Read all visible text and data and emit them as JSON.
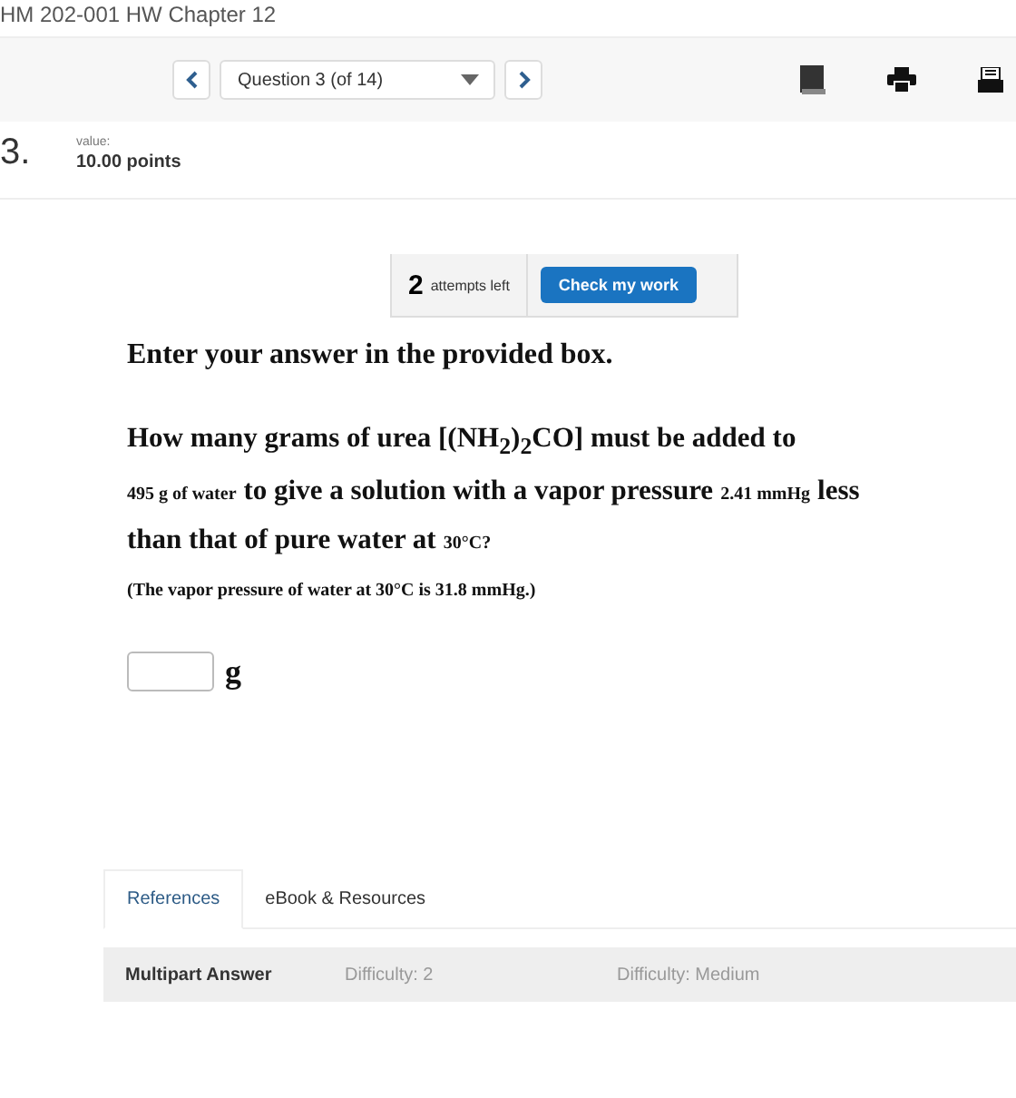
{
  "assignment_title": "HM 202-001 HW Chapter 12",
  "nav": {
    "question_select": "Question 3 (of 14)"
  },
  "question": {
    "number": "3.",
    "value_label": "value:",
    "points": "10.00 points"
  },
  "attempts": {
    "count": "2",
    "label": "attempts left",
    "button": "Check my work"
  },
  "instruction": "Enter your answer in the provided box.",
  "prompt": [
    [
      {
        "kind": "main",
        "text": "How many grams of urea [(NH$_{2}$)$_{2}$CO] must be added to"
      }
    ],
    [
      {
        "kind": "value",
        "text": "495 g of water"
      },
      {
        "kind": "main",
        "text": "to give a solution with a vapor pressure"
      },
      {
        "kind": "value",
        "text": "2.41 mmHg"
      },
      {
        "kind": "main",
        "text": "less"
      }
    ],
    [
      {
        "kind": "main",
        "text": "than that of pure water at"
      },
      {
        "kind": "value",
        "text": "30°C?"
      }
    ]
  ],
  "note": "(The vapor pressure of water at 30°C is 31.8 mmHg.)",
  "answer": {
    "unit": "g"
  },
  "tabs": [
    {
      "label": "References",
      "selected": true
    },
    {
      "label": "eBook & Resources",
      "selected": false
    }
  ],
  "info_bar": [
    "Multipart Answer",
    "Difficulty: 2",
    "Difficulty: Medium"
  ]
}
